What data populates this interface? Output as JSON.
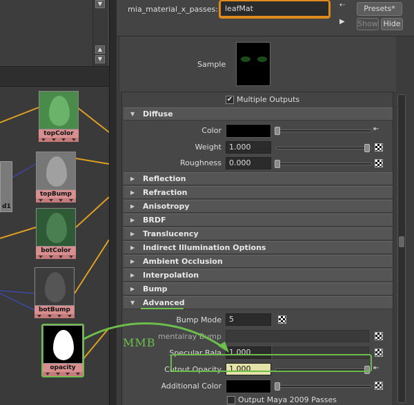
{
  "graph": {
    "nodes": [
      {
        "label": "topColor"
      },
      {
        "label": "topBump"
      },
      {
        "label": "botColor"
      },
      {
        "label": "botBump"
      },
      {
        "label": "opacity"
      }
    ],
    "stub_label": "d1",
    "scroll_up": "▲",
    "scroll_down": "▼"
  },
  "header": {
    "attr_label": "mia_material_x_passes:",
    "node_name": "leafMat",
    "presets_label": "Presets*",
    "show_label": "Show",
    "hide_label": "Hide"
  },
  "sample": {
    "label": "Sample"
  },
  "multiple_outputs": {
    "label": "Multiple Outputs",
    "checked": true
  },
  "diffuse": {
    "title": "Diffuse",
    "color_label": "Color",
    "weight_label": "Weight",
    "weight_value": "1.000",
    "roughness_label": "Roughness",
    "roughness_value": "0.000"
  },
  "sections": [
    "Reflection",
    "Refraction",
    "Anisotropy",
    "BRDF",
    "Translucency",
    "Indirect Illumination Options",
    "Ambient Occlusion",
    "Interpolation",
    "Bump"
  ],
  "advanced": {
    "title": "Advanced",
    "bump_mode_label": "Bump Mode",
    "bump_mode_value": "5",
    "mentalray_bump_label": "mentalray Bump",
    "specular_balance_label": "Specular Bala",
    "specular_balance_value": "1.000",
    "cutout_opacity_label": "Cutout Opacity",
    "cutout_opacity_value": "1.000",
    "additional_color_label": "Additional Color",
    "output_maya_label": "Output Maya 2009 Passes"
  },
  "annotation": {
    "text": "MMB"
  },
  "colors": {
    "accent_orange": "#e08a1e",
    "annotation_green": "#6bbf4a",
    "node_pink": "#d88f8f"
  }
}
